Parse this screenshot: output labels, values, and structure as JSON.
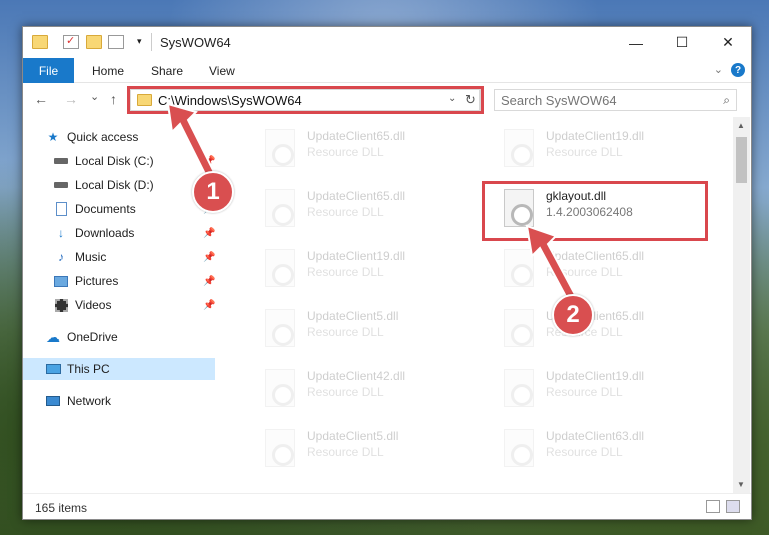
{
  "window": {
    "title": "SysWOW64",
    "minimize": "—",
    "maximize": "☐",
    "close": "✕"
  },
  "ribbon": {
    "file_tab": "File",
    "tabs": [
      "Home",
      "Share",
      "View"
    ],
    "help": "?"
  },
  "nav": {
    "back": "←",
    "forward": "→",
    "recent": "⌄",
    "up": "↑",
    "address": "C:\\Windows\\SysWOW64",
    "address_dropdown": "⌄",
    "refresh": "↻",
    "search_placeholder": "Search SysWOW64",
    "search_icon": "⌕"
  },
  "sidebar": {
    "quick_access": "Quick access",
    "items": [
      {
        "label": "Local Disk (C:)",
        "icon": "drive-icon"
      },
      {
        "label": "Local Disk (D:)",
        "icon": "drive-icon"
      },
      {
        "label": "Documents",
        "icon": "documents-icon"
      },
      {
        "label": "Downloads",
        "icon": "downloads-icon"
      },
      {
        "label": "Music",
        "icon": "music-icon"
      },
      {
        "label": "Pictures",
        "icon": "pictures-icon"
      },
      {
        "label": "Videos",
        "icon": "videos-icon"
      }
    ],
    "onedrive": "OneDrive",
    "this_pc": "This PC",
    "network": "Network"
  },
  "files": [
    {
      "name": "UpdateClient65.dll",
      "desc": "Resource DLL",
      "faded": true
    },
    {
      "name": "UpdateClient19.dll",
      "desc": "Resource DLL",
      "faded": true
    },
    {
      "name": "UpdateClient65.dll",
      "desc": "Resource DLL",
      "faded": true
    },
    {
      "name": "gklayout.dll",
      "desc": "1.4.2003062408",
      "faded": false
    },
    {
      "name": "UpdateClient19.dll",
      "desc": "Resource DLL",
      "faded": true
    },
    {
      "name": "UpdateClient65.dll",
      "desc": "Resource DLL",
      "faded": true
    },
    {
      "name": "UpdateClient5.dll",
      "desc": "Resource DLL",
      "faded": true
    },
    {
      "name": "UpdateClient65.dll",
      "desc": "Resource DLL",
      "faded": true
    },
    {
      "name": "UpdateClient42.dll",
      "desc": "Resource DLL",
      "faded": true
    },
    {
      "name": "UpdateClient19.dll",
      "desc": "Resource DLL",
      "faded": true
    },
    {
      "name": "UpdateClient5.dll",
      "desc": "Resource DLL",
      "faded": true
    },
    {
      "name": "UpdateClient63.dll",
      "desc": "Resource DLL",
      "faded": true
    }
  ],
  "status": {
    "items": "165 items"
  },
  "callouts": [
    "1",
    "2"
  ],
  "colors": {
    "accent": "#1979ca",
    "highlight": "#d9474d",
    "selection": "#cce8ff"
  }
}
